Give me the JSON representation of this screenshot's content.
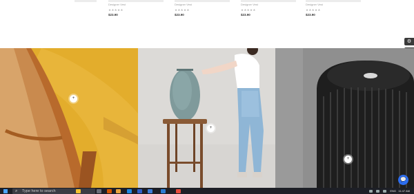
{
  "products": [
    {
      "vendor": "Designer Vest",
      "stars": "★★★★★",
      "price": "$23.90"
    },
    {
      "vendor": "Designer Vest",
      "stars": "★★★★★",
      "price": "$23.90"
    },
    {
      "vendor": "Designer Vest",
      "stars": "★★★★★",
      "price": "$23.90"
    },
    {
      "vendor": "Designer Vest",
      "stars": "★★★★★",
      "price": "$23.90"
    }
  ],
  "side_tools": [
    {
      "icon": "gear-icon",
      "glyph": "⚙"
    },
    {
      "icon": "layers-icon",
      "glyph": "≡"
    },
    {
      "icon": "contrast-icon",
      "glyph": "◐"
    }
  ],
  "hotspot_glyph": "+",
  "chat_glyph": "💬",
  "taskbar": {
    "search_placeholder": "Type here to search",
    "search_glyph": "⌕",
    "lang": "ENG",
    "time": "11:47 AM"
  },
  "colors": {
    "chair_banner": "#e3ad2c",
    "speaker_banner": "#d7d5d2",
    "purifier_banner": "#8f8f8f",
    "taskbar": "#1d1f26",
    "chat_button": "#2c6df0"
  }
}
